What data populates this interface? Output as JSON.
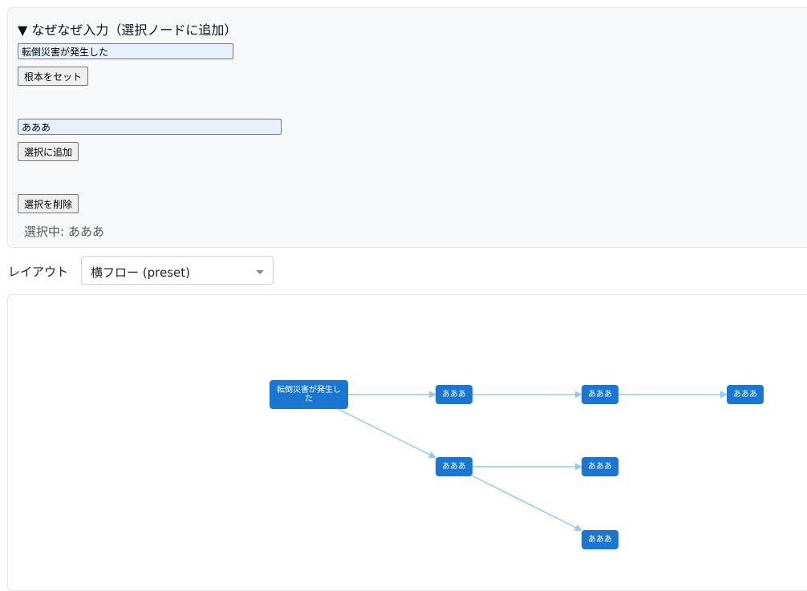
{
  "why_panel": {
    "summary": "▼ なぜなぜ入力（選択ノードに追加）",
    "root_input_value": "転倒災害が発生した",
    "set_root_label": "根本をセット",
    "child_input_value": "あああ",
    "add_to_selected_label": "選択に追加",
    "delete_selected_label": "選択を削除",
    "selected_status": "選択中: あああ"
  },
  "layout": {
    "label": "レイアウト",
    "selected": "横フロー (preset)"
  },
  "graph": {
    "node_color": "#1976d2",
    "edge_color": "#90caf9",
    "nodes": [
      {
        "id": "n0",
        "label_lines": [
          "転倒災害が発生し",
          "た"
        ]
      },
      {
        "id": "n1",
        "label_lines": [
          "あああ"
        ]
      },
      {
        "id": "n2",
        "label_lines": [
          "あああ"
        ]
      },
      {
        "id": "n3",
        "label_lines": [
          "あああ"
        ]
      },
      {
        "id": "n4",
        "label_lines": [
          "あああ"
        ]
      },
      {
        "id": "n5",
        "label_lines": [
          "あああ"
        ]
      },
      {
        "id": "n6",
        "label_lines": [
          "あああ"
        ]
      }
    ],
    "edges": [
      {
        "from": "n0",
        "to": "n1"
      },
      {
        "from": "n0",
        "to": "n4"
      },
      {
        "from": "n1",
        "to": "n2"
      },
      {
        "from": "n2",
        "to": "n3"
      },
      {
        "from": "n4",
        "to": "n5"
      },
      {
        "from": "n4",
        "to": "n6"
      }
    ]
  }
}
